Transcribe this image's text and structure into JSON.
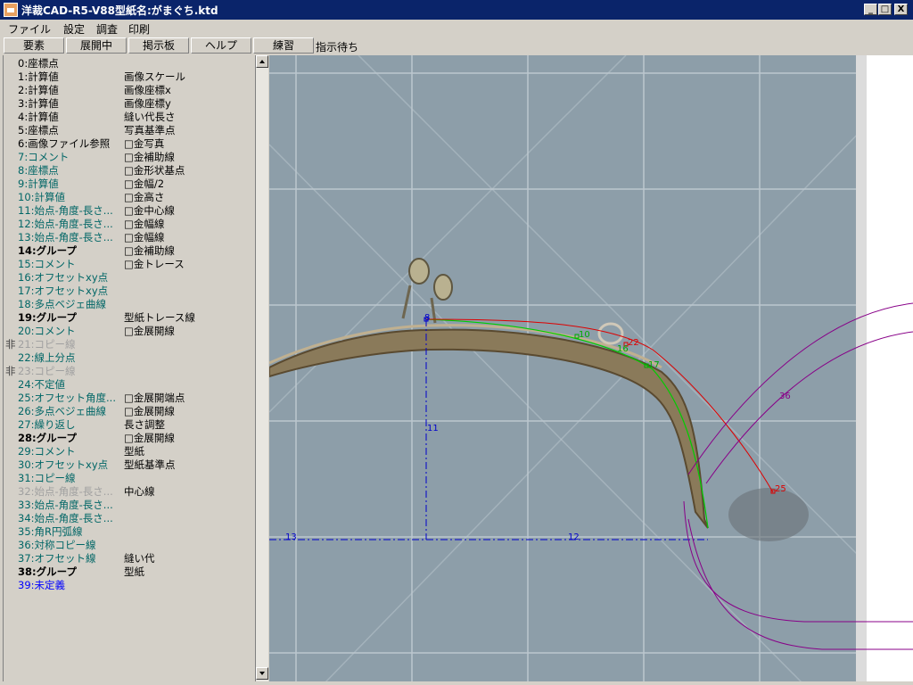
{
  "window": {
    "title": "洋裁CAD-R5-V88型紙名:がまぐち.ktd",
    "minimize": "_",
    "maximize": "□",
    "close": "X"
  },
  "menu": [
    "ファイル",
    "設定",
    "調査",
    "印刷"
  ],
  "toolbar": {
    "buttons": [
      "要素",
      "展開中",
      "掲示板",
      "ヘルプ",
      "練習"
    ],
    "status": "指示待ち"
  },
  "elements": [
    {
      "label": "0:座標点",
      "value": "",
      "style": "black",
      "prefix": ""
    },
    {
      "label": "1:計算値",
      "value": "画像スケール",
      "style": "black",
      "prefix": ""
    },
    {
      "label": "2:計算値",
      "value": "画像座標x",
      "style": "black",
      "prefix": ""
    },
    {
      "label": "3:計算値",
      "value": "画像座標y",
      "style": "black",
      "prefix": ""
    },
    {
      "label": "4:計算値",
      "value": "縫い代長さ",
      "style": "black",
      "prefix": ""
    },
    {
      "label": "5:座標点",
      "value": "写真基準点",
      "style": "black",
      "prefix": ""
    },
    {
      "label": "6:画像ファイル参照",
      "value": "□金写真",
      "style": "black",
      "prefix": ""
    },
    {
      "label": "7:コメント",
      "value": "□金補助線",
      "style": "teal",
      "prefix": ""
    },
    {
      "label": "8:座標点",
      "value": "□金形状基点",
      "style": "teal",
      "prefix": ""
    },
    {
      "label": "9:計算値",
      "value": "□金幅/2",
      "style": "teal",
      "prefix": ""
    },
    {
      "label": "10:計算値",
      "value": "□金高さ",
      "style": "teal",
      "prefix": ""
    },
    {
      "label": "11:始点-角度-長さ...",
      "value": "□金中心線",
      "style": "teal",
      "prefix": ""
    },
    {
      "label": "12:始点-角度-長さ...",
      "value": "□金幅線",
      "style": "teal",
      "prefix": ""
    },
    {
      "label": "13:始点-角度-長さ...",
      "value": "□金幅線",
      "style": "teal",
      "prefix": ""
    },
    {
      "label": "14:グループ",
      "value": "□金補助線",
      "style": "bold",
      "prefix": ""
    },
    {
      "label": "15:コメント",
      "value": "□金トレース",
      "style": "teal",
      "prefix": ""
    },
    {
      "label": "16:オフセットxy点",
      "value": "",
      "style": "teal",
      "prefix": ""
    },
    {
      "label": "17:オフセットxy点",
      "value": "",
      "style": "teal",
      "prefix": ""
    },
    {
      "label": "18:多点ベジェ曲線",
      "value": "",
      "style": "teal",
      "prefix": ""
    },
    {
      "label": "19:グループ",
      "value": "型紙トレース線",
      "style": "bold",
      "prefix": ""
    },
    {
      "label": "20:コメント",
      "value": "□金展開線",
      "style": "teal",
      "prefix": ""
    },
    {
      "label": "21:コピー線",
      "value": "",
      "style": "gray",
      "prefix": "非"
    },
    {
      "label": "22:線上分点",
      "value": "",
      "style": "teal",
      "prefix": ""
    },
    {
      "label": "23:コピー線",
      "value": "",
      "style": "gray",
      "prefix": "非"
    },
    {
      "label": "24:不定値",
      "value": "",
      "style": "teal",
      "prefix": ""
    },
    {
      "label": "25:オフセット角度...",
      "value": "□金展開端点",
      "style": "teal",
      "prefix": ""
    },
    {
      "label": "26:多点ベジェ曲線",
      "value": "□金展開線",
      "style": "teal",
      "prefix": ""
    },
    {
      "label": "27:繰り返し",
      "value": "長さ調整",
      "style": "teal",
      "prefix": ""
    },
    {
      "label": "28:グループ",
      "value": "□金展開線",
      "style": "bold",
      "prefix": ""
    },
    {
      "label": "29:コメント",
      "value": "型紙",
      "style": "teal",
      "prefix": ""
    },
    {
      "label": "30:オフセットxy点",
      "value": "型紙基準点",
      "style": "teal",
      "prefix": ""
    },
    {
      "label": "31:コピー線",
      "value": "",
      "style": "teal",
      "prefix": ""
    },
    {
      "label": "32:始点-角度-長さ...",
      "value": "中心線",
      "style": "gray",
      "prefix": ""
    },
    {
      "label": "33:始点-角度-長さ...",
      "value": "",
      "style": "teal",
      "prefix": ""
    },
    {
      "label": "34:始点-角度-長さ...",
      "value": "",
      "style": "teal",
      "prefix": ""
    },
    {
      "label": "35:角R円弧線",
      "value": "",
      "style": "teal",
      "prefix": ""
    },
    {
      "label": "36:対称コピー線",
      "value": "",
      "style": "teal",
      "prefix": ""
    },
    {
      "label": "37:オフセット線",
      "value": "縫い代",
      "style": "teal",
      "prefix": ""
    },
    {
      "label": "38:グループ",
      "value": "型紙",
      "style": "bold",
      "prefix": ""
    },
    {
      "label": "39:未定義",
      "value": "",
      "style": "blue",
      "prefix": ""
    }
  ],
  "scroll": {
    "up": "▲",
    "down": "▼"
  },
  "canvas_labels": {
    "p8": "8",
    "p10": "10",
    "p16": "16",
    "p17": "17",
    "p22": "22",
    "p25": "25",
    "l11": "11",
    "l12": "12",
    "l13": "13",
    "l36": "36"
  }
}
